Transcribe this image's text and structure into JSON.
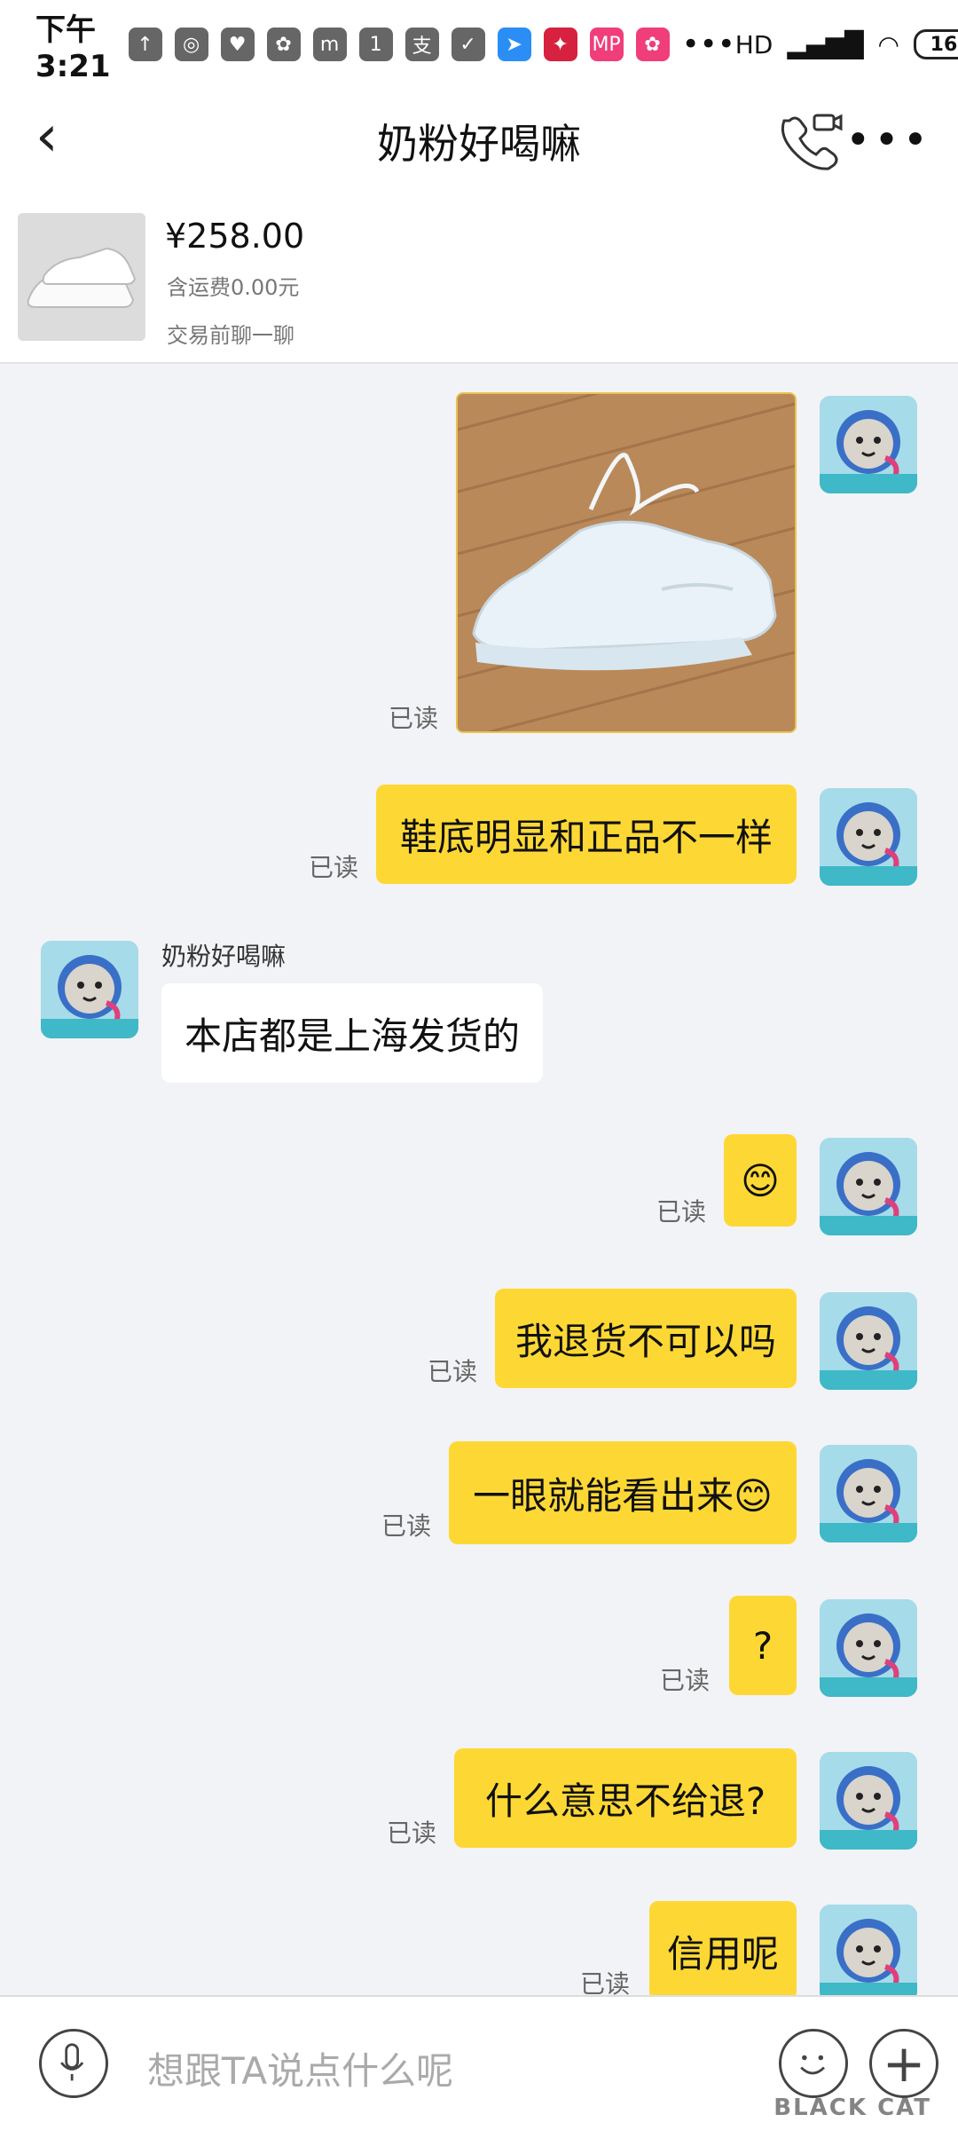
{
  "status_bar": {
    "time": "下午3:21",
    "battery": "16",
    "network": "HD"
  },
  "header": {
    "title": "奶粉好喝嘛"
  },
  "product": {
    "price": "¥258.00",
    "shipping": "含运费0.00元",
    "chat_link": "交易前聊一聊"
  },
  "messages": {
    "read_label": "已读",
    "m1": "鞋底明显和正品不一样",
    "sender_name": "奶粉好喝嘛",
    "m2": "本店都是上海发货的",
    "m3": "😊",
    "m4": "我退货不可以吗",
    "m5": "一眼就能看出来😊",
    "m6": "?",
    "m7": "什么意思不给退?",
    "m8": "信用呢"
  },
  "input": {
    "placeholder": "想跟TA说点什么呢"
  },
  "watermark": "BLACK CAT"
}
